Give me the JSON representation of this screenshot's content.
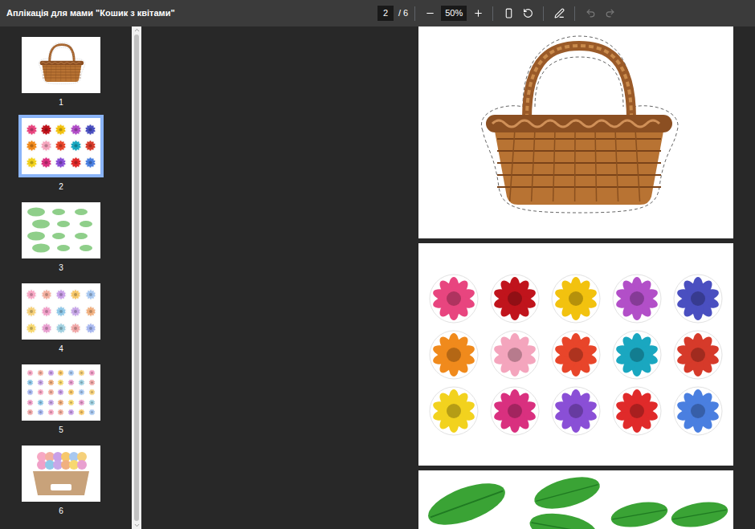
{
  "window": {
    "title": "Аплікація для мами \"Кошик з квітами\""
  },
  "toolbar": {
    "page": "2",
    "page_total": "/ 6",
    "zoom": "50%",
    "undo_disabled": true,
    "redo_disabled": true
  },
  "thumbnails": [
    {
      "label": "1",
      "selected": false,
      "kind": "basket"
    },
    {
      "label": "2",
      "selected": true,
      "kind": "flowers"
    },
    {
      "label": "3",
      "selected": false,
      "kind": "leaves"
    },
    {
      "label": "4",
      "selected": false,
      "kind": "pastel"
    },
    {
      "label": "5",
      "selected": false,
      "kind": "small"
    },
    {
      "label": "6",
      "selected": false,
      "kind": "bouquet"
    }
  ],
  "pages": [
    {
      "kind": "basket"
    },
    {
      "kind": "flowers",
      "flowers": [
        {
          "color": "#e8457f"
        },
        {
          "color": "#c0141c"
        },
        {
          "color": "#f2c20f"
        },
        {
          "color": "#b24fc8"
        },
        {
          "color": "#4a4fc0"
        },
        {
          "color": "#f08a1c"
        },
        {
          "color": "#f4a5bd"
        },
        {
          "color": "#e8452a"
        },
        {
          "color": "#1aa7c0"
        },
        {
          "color": "#d63a2a"
        },
        {
          "color": "#f2d21e"
        },
        {
          "color": "#d9307f"
        },
        {
          "color": "#8a4fd6"
        },
        {
          "color": "#e02a2a"
        },
        {
          "color": "#4a7fe0"
        }
      ]
    },
    {
      "kind": "leaves"
    }
  ]
}
